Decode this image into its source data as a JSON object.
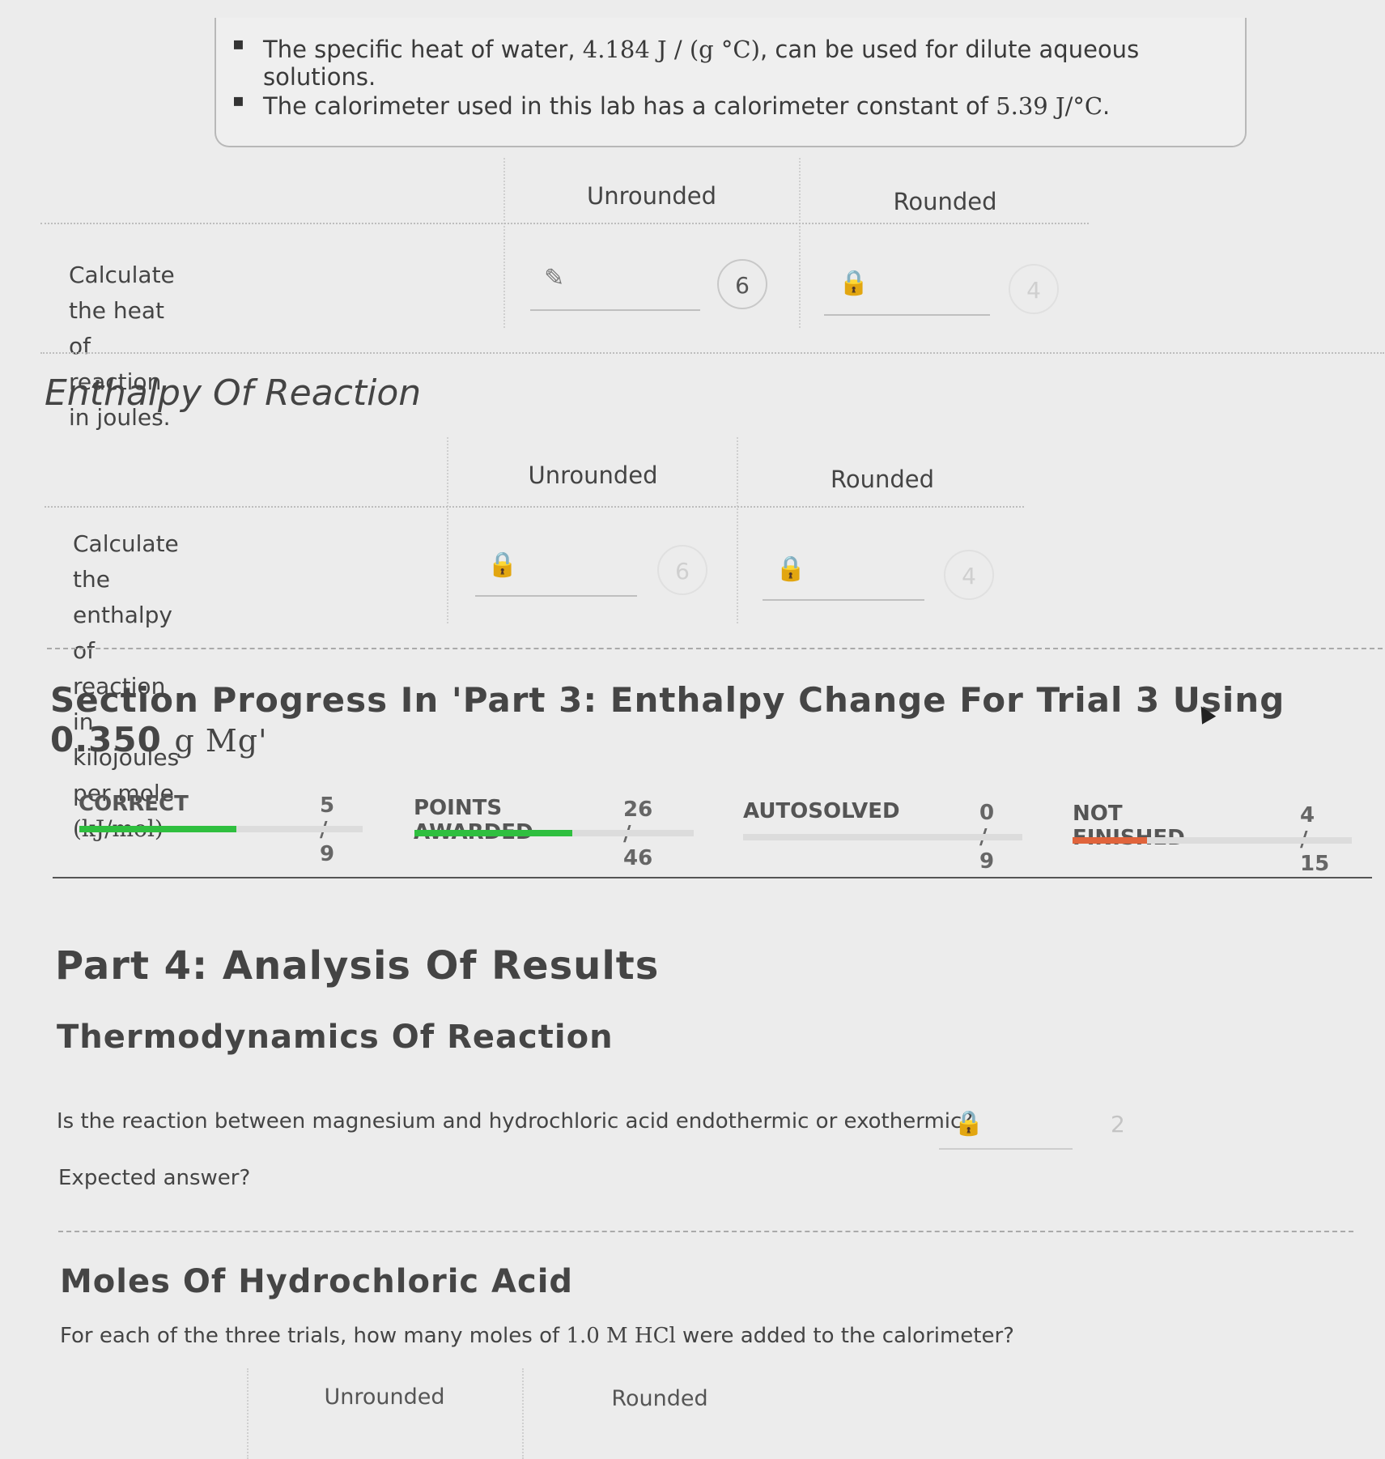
{
  "notes": {
    "water": [
      "The specific heat of water, ",
      "4.184 J / (g °C)",
      ", can be used for dilute aqueous solutions."
    ],
    "calorimeter": [
      "The calorimeter used in this lab has a calorimeter constant of ",
      "5.39 J/°C",
      "."
    ]
  },
  "heat_table": {
    "col_unrounded": "Unrounded",
    "col_rounded": "Rounded",
    "row_label": "Calculate the heat of reaction in joules.",
    "unrounded_badge": "6",
    "rounded_badge": "4"
  },
  "enthalpy": {
    "heading": "Enthalpy Of Reaction",
    "col_unrounded": "Unrounded",
    "col_rounded": "Rounded",
    "row_label_1": "Calculate the enthalpy of reaction",
    "row_label_2a": "in kilojoules per mole ",
    "row_label_2b": "(kJ/mol)",
    "unrounded_badge": "6",
    "rounded_badge": "4"
  },
  "progress": {
    "heading_a": "Section Progress In 'Part 3: Enthalpy Change For Trial 3 Using 0.350 ",
    "heading_b": "g Mg'",
    "stats": [
      {
        "label": "CORRECT",
        "value": "5 / 9",
        "fraction": 0.5556,
        "color": "#2fbf3f"
      },
      {
        "label": "POINTS AWARDED",
        "value": "26 / 46",
        "fraction": 0.5652,
        "color": "#2fbf3f"
      },
      {
        "label": "AUTOSOLVED",
        "value": "0 / 9",
        "fraction": 0.0,
        "color": "#2fbf3f"
      },
      {
        "label": "NOT FINISHED",
        "value": "4 / 15",
        "fraction": 0.2667,
        "color": "#e0643c"
      }
    ]
  },
  "part4": {
    "heading": "Part 4: Analysis Of Results",
    "thermo_heading": "Thermodynamics Of Reaction",
    "thermo_question": "Is the reaction between magnesium and hydrochloric acid endothermic or exothermic?",
    "thermo_badge": "2",
    "expected": "Expected answer?",
    "moles_heading": "Moles Of Hydrochloric Acid",
    "moles_q_a": "For each of the three trials, how many moles of ",
    "moles_q_b": "1.0 M HCl",
    "moles_q_c": " were added to the calorimeter?",
    "col_unrounded": "Unrounded",
    "col_rounded": "Rounded"
  },
  "icons": {
    "pencil": "✎",
    "lock": "🔒",
    "cursor": "▲"
  }
}
